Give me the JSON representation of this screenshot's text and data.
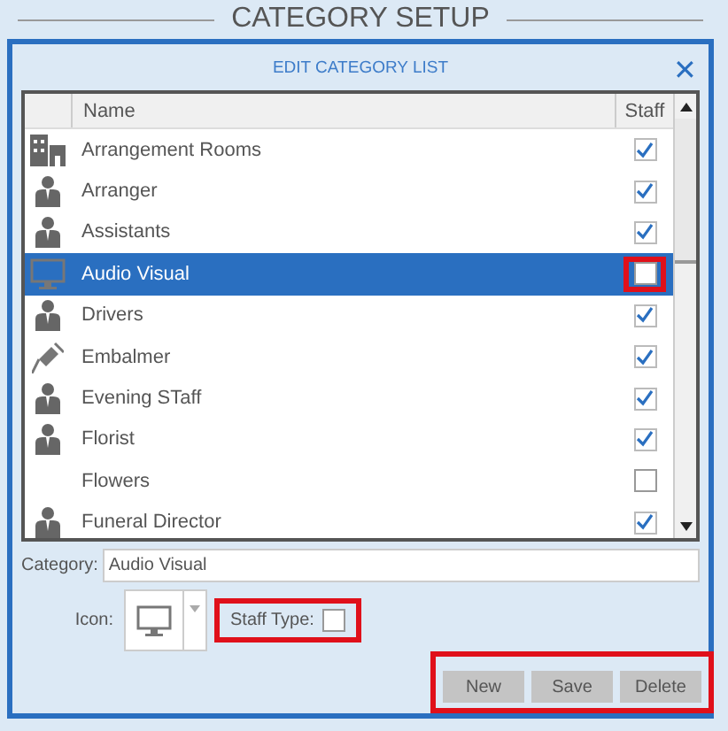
{
  "page_title": "CATEGORY SETUP",
  "dialog": {
    "title": "EDIT CATEGORY LIST",
    "close": "✕"
  },
  "list": {
    "columns": [
      "Name",
      "Staff"
    ],
    "rows": [
      {
        "name": "Arrangement Rooms",
        "kind": "building",
        "checked": true,
        "selected": false,
        "highlighted": false
      },
      {
        "name": "Arranger",
        "kind": "person",
        "checked": true,
        "selected": false,
        "highlighted": false
      },
      {
        "name": "Assistants",
        "kind": "person",
        "checked": true,
        "selected": false,
        "highlighted": false
      },
      {
        "name": "Audio Visual",
        "kind": "monitor",
        "checked": false,
        "selected": true,
        "highlighted": true
      },
      {
        "name": "Drivers",
        "kind": "person",
        "checked": true,
        "selected": false,
        "highlighted": false
      },
      {
        "name": "Embalmer",
        "kind": "syringe",
        "checked": true,
        "selected": false,
        "highlighted": false
      },
      {
        "name": "Evening STaff",
        "kind": "person",
        "checked": true,
        "selected": false,
        "highlighted": false
      },
      {
        "name": "Florist",
        "kind": "person",
        "checked": true,
        "selected": false,
        "highlighted": false
      },
      {
        "name": "Flowers",
        "kind": "plain",
        "checked": false,
        "selected": false,
        "highlighted": false
      },
      {
        "name": "Funeral Director",
        "kind": "person",
        "checked": true,
        "selected": false,
        "highlighted": false
      }
    ]
  },
  "category": {
    "label": "Category:",
    "value": "Audio Visual"
  },
  "icon_picker": {
    "label": "Icon:",
    "kind": "monitor"
  },
  "staff_type": {
    "label": "Staff Type:",
    "checked": false,
    "highlighted": true
  },
  "buttons": {
    "highlighted": true,
    "items": [
      "New",
      "Save",
      "Delete"
    ]
  }
}
